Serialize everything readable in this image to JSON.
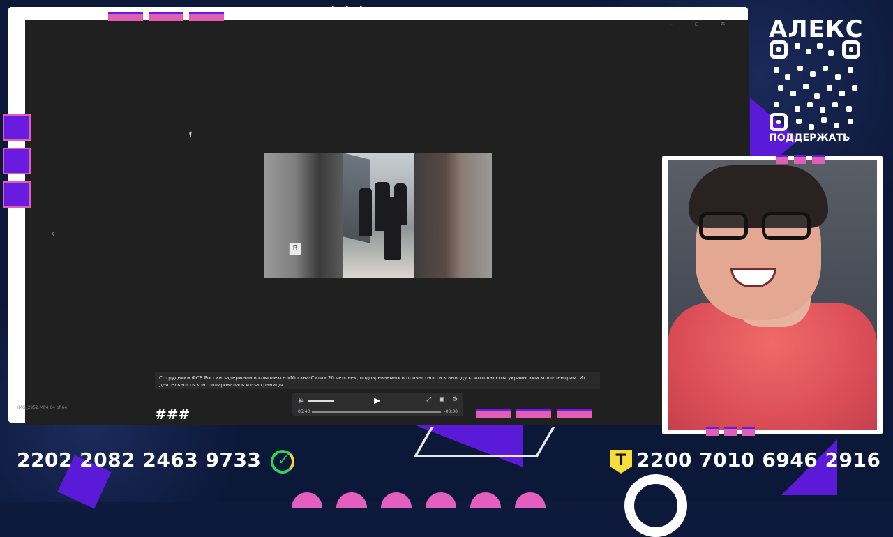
{
  "overlay": {
    "channel_name": "АЛЕКС",
    "support_label": "ПОДДЕРЖАТЬ",
    "card_left": "2202 2082 2463 9733",
    "card_right": "2200 7010 6946 2916",
    "bank_left_icon": "sber-icon",
    "bank_right_icon": "tbank-icon",
    "bank_right_letter": "Т",
    "accent_purple": "#6a1be0",
    "accent_pink": "#e05fb4"
  },
  "viewer": {
    "window_controls": "– ▫ ✕",
    "caption": "Сотрудники ФСБ России  задержали в комплексе «Москва-Сити» 20 человек, подозреваемых в причастности к выводу криптовалюты украинским колл-центрам. Их деятельность контролировалась из-за границы",
    "file_name": "IMG_2952.MP4 64 of 64",
    "player": {
      "time_current": "05:40",
      "time_remaining": "-00:00"
    }
  }
}
